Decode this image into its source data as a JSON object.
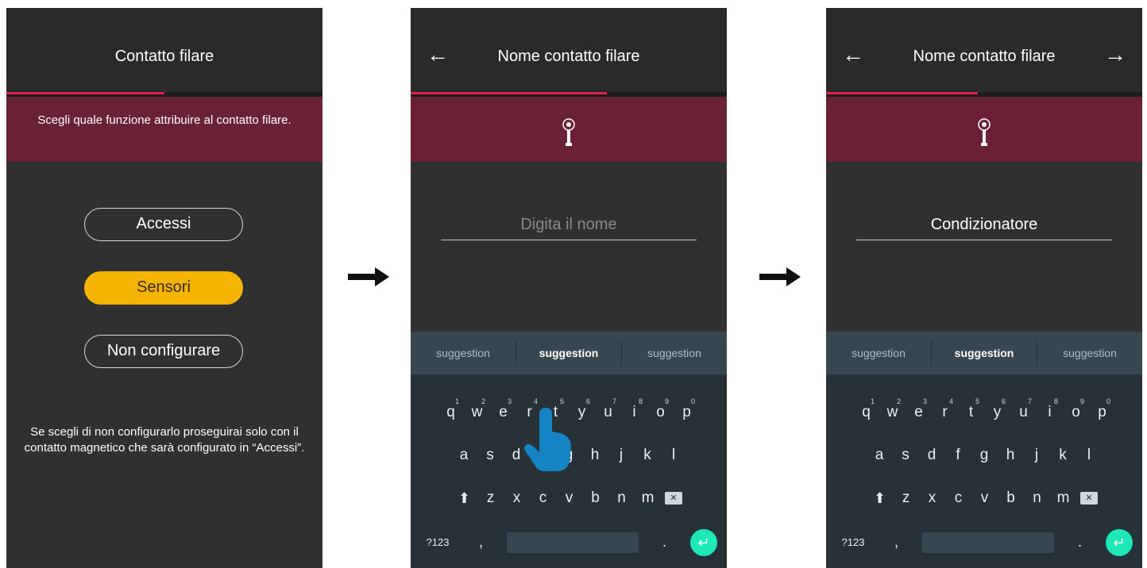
{
  "screen1": {
    "title": "Contatto filare",
    "instruction": "Scegli quale funzione attribuire al contatto filare.",
    "options": [
      "Accessi",
      "Sensori",
      "Non configurare"
    ],
    "selected_option": "Sensori",
    "note": "Se scegli di non configurarlo proseguirai solo con il contatto magnetico che sarà configurato in “Accessi”.",
    "progress": 0.5
  },
  "screen2": {
    "title": "Nome contatto filare",
    "back_icon": "arrow-left-icon",
    "band_icon": "sensor-signal-icon",
    "name_placeholder": "Digita il nome",
    "progress": 0.62
  },
  "screen3": {
    "title": "Nome contatto filare",
    "back_icon": "arrow-left-icon",
    "forward_icon": "arrow-right-icon",
    "band_icon": "sensor-signal-icon",
    "name_value": "Condizionatore",
    "progress": 0.48
  },
  "keyboard": {
    "suggestions": [
      "suggestion",
      "suggestion",
      "suggestion"
    ],
    "row1": [
      "q",
      "w",
      "e",
      "r",
      "t",
      "y",
      "u",
      "i",
      "o",
      "p"
    ],
    "row1_numbers": [
      "1",
      "2",
      "3",
      "4",
      "5",
      "6",
      "7",
      "8",
      "9",
      "0"
    ],
    "row2": [
      "a",
      "s",
      "d",
      "f",
      "g",
      "h",
      "j",
      "k",
      "l"
    ],
    "row3": [
      "z",
      "x",
      "c",
      "v",
      "b",
      "n",
      "m"
    ],
    "symbols_key": "?123",
    "comma_key": ",",
    "period_key": "."
  },
  "colors": {
    "band": "#6b2135",
    "progress": "#e4204f",
    "selected_button": "#f4b400",
    "enter_key": "#1de9b6"
  },
  "icons": [
    "arrow-right-icon",
    "hand-pointer-icon",
    "shift-icon",
    "backspace-icon",
    "enter-icon"
  ]
}
